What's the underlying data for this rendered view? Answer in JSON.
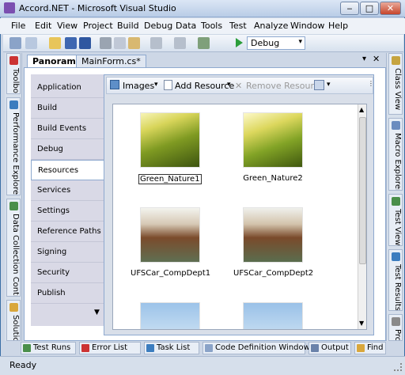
{
  "window": {
    "title": "Accord.NET - Microsoft Visual Studio"
  },
  "menu": [
    "File",
    "Edit",
    "View",
    "Project",
    "Build",
    "Debug",
    "Data",
    "Tools",
    "Test",
    "Analyze",
    "Window",
    "Help"
  ],
  "toolbar": {
    "config": "Debug"
  },
  "tabs": [
    {
      "label": "Panorama",
      "active": true
    },
    {
      "label": "MainForm.cs*",
      "active": false
    }
  ],
  "left_dock": [
    "Toolbox",
    "Performance Explorer",
    "Data Collection Control",
    "Solution Explo"
  ],
  "right_dock": [
    "Class View",
    "Macro Explorer",
    "Test View",
    "Test Results",
    "Properties"
  ],
  "nav": {
    "items": [
      "Application",
      "Build",
      "Build Events",
      "Debug",
      "Resources",
      "Services",
      "Settings",
      "Reference Paths",
      "Signing",
      "Security",
      "Publish"
    ],
    "selected": "Resources"
  },
  "resources_toolbar": {
    "type": "Images",
    "add": "Add Resource",
    "remove": "Remove Resource"
  },
  "resources": [
    {
      "name": "Green_Nature1",
      "selected": true
    },
    {
      "name": "Green_Nature2",
      "selected": false
    },
    {
      "name": "UFSCar_CompDept1",
      "selected": false
    },
    {
      "name": "UFSCar_CompDept2",
      "selected": false
    }
  ],
  "bottom_tabs": [
    "Test Runs",
    "Error List",
    "Task List",
    "Code Definition Window",
    "Output",
    "Find Symbol Results"
  ],
  "status": "Ready",
  "colors": {
    "accent": "#3a6ea5",
    "panel": "#d9d9e6"
  }
}
